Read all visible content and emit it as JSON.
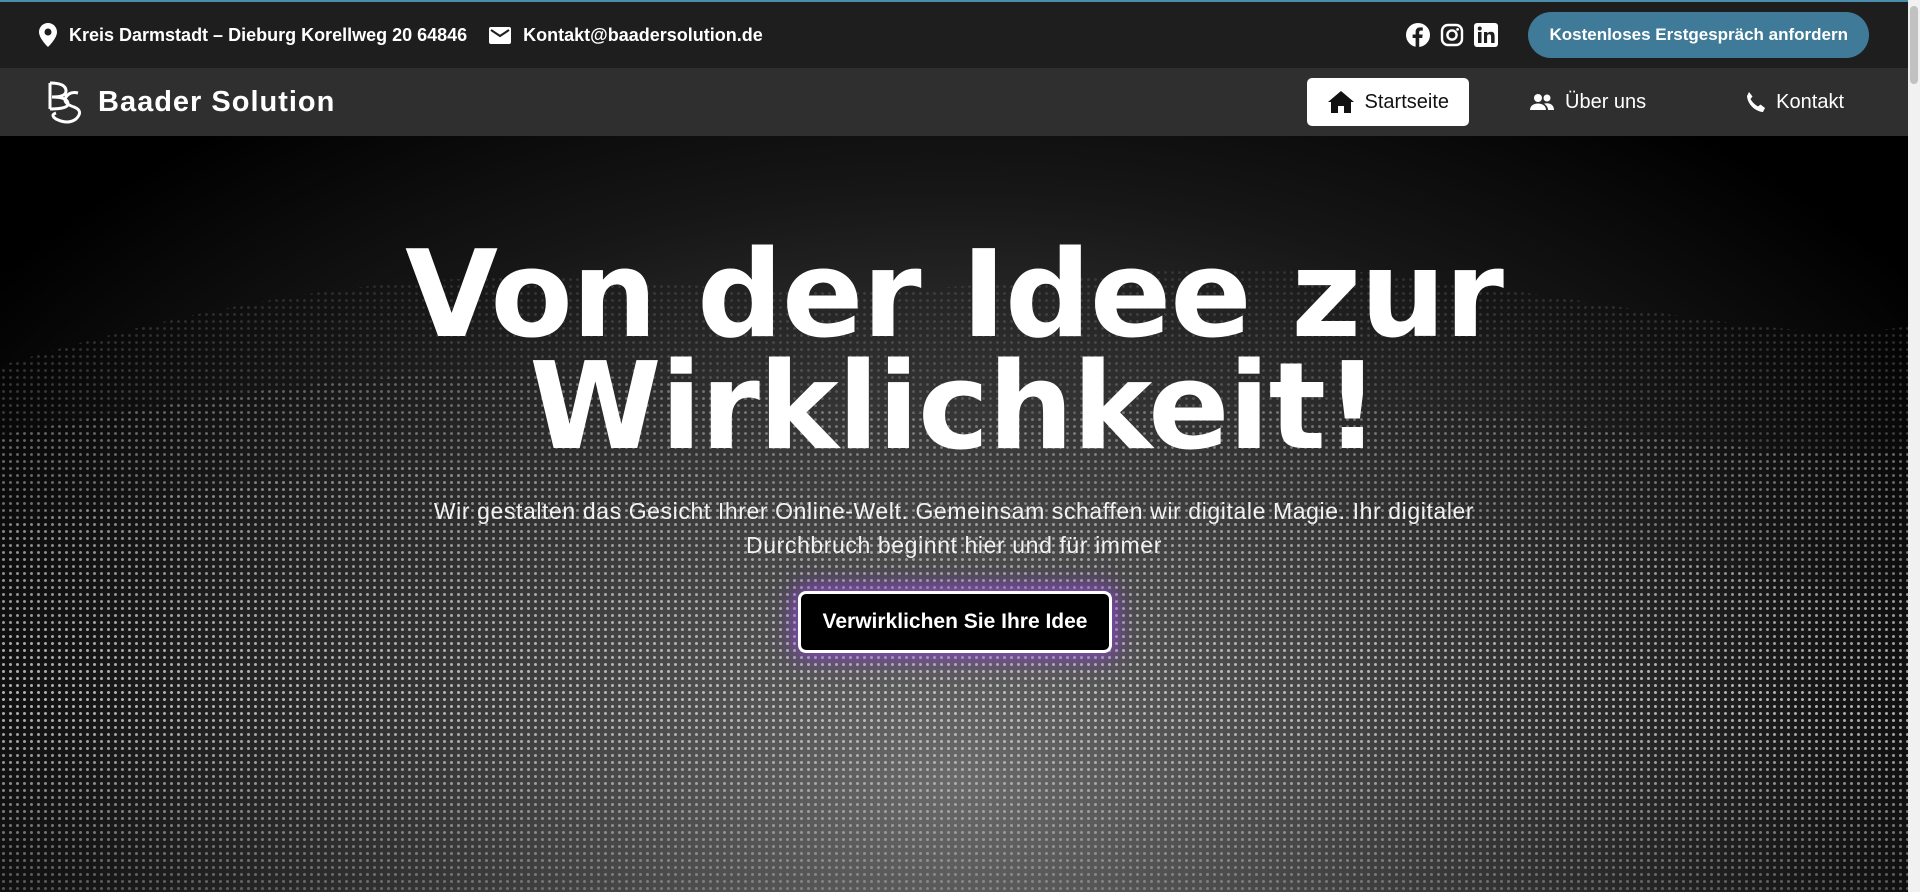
{
  "topbar": {
    "address": "Kreis Darmstadt – Dieburg Korellweg 20 64846",
    "email": "Kontakt@baadersolution.de",
    "cta_label": "Kostenloses Erstgespräch anfordern",
    "socials": [
      "facebook-icon",
      "instagram-icon",
      "linkedin-icon"
    ]
  },
  "nav": {
    "brand": "Baader Solution",
    "items": [
      {
        "label": "Startseite",
        "icon": "home-icon",
        "active": true
      },
      {
        "label": "Über uns",
        "icon": "users-icon",
        "active": false
      },
      {
        "label": "Kontakt",
        "icon": "phone-icon",
        "active": false
      }
    ]
  },
  "hero": {
    "headline_line1": "Von der Idee zur",
    "headline_line2": "Wirklichkeit!",
    "subline_line1": "Wir gestalten das Gesicht Ihrer Online-Welt. Gemeinsam schaffen wir digitale Magie. Ihr digitaler",
    "subline_line2": "Durchbruch beginnt hier und für immer",
    "cta_label": "Verwirklichen Sie Ihre Idee"
  },
  "colors": {
    "topbar_bg": "#1e1e1e",
    "navbar_bg": "#2f2f2f",
    "accent_blue": "#3f7b98",
    "cta_glow": "#9646e6"
  }
}
